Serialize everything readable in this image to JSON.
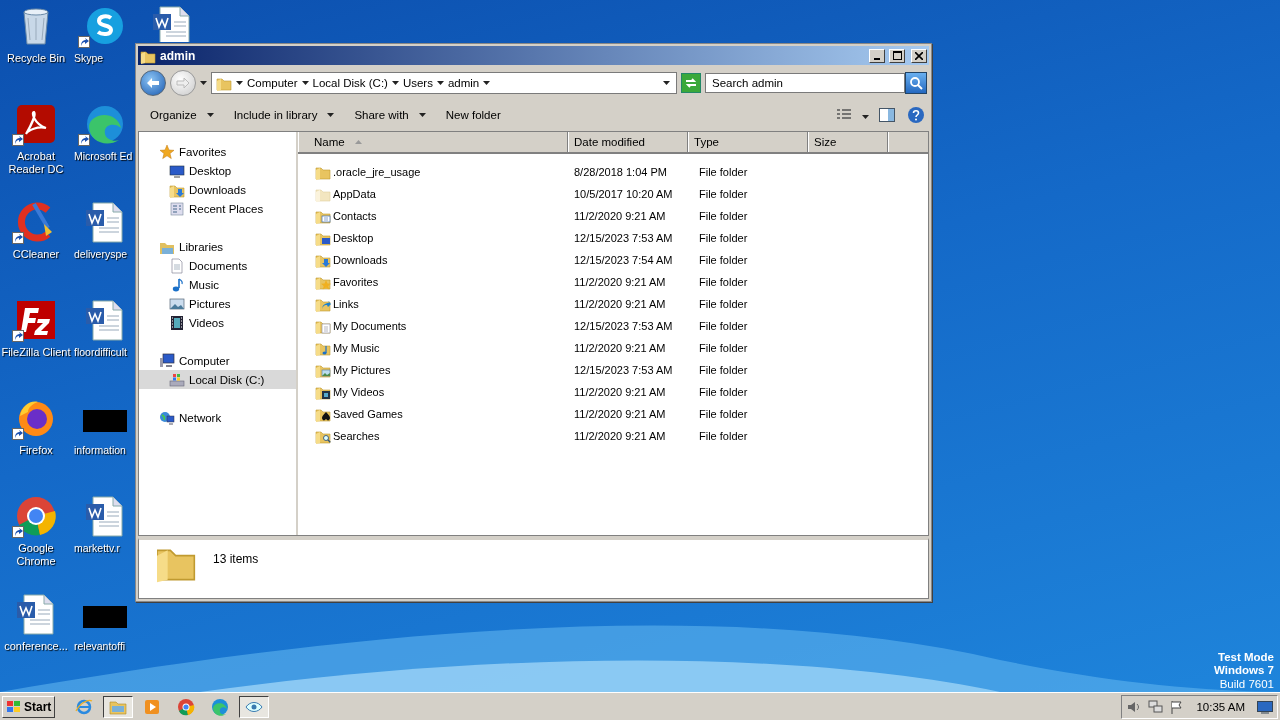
{
  "desktop_columns": [
    [
      {
        "label": "Recycle Bin",
        "kind": "recycle",
        "shortcut": false
      },
      {
        "label": "Acrobat Reader DC",
        "kind": "acrobat",
        "shortcut": true
      },
      {
        "label": "CCleaner",
        "kind": "ccleaner",
        "shortcut": true
      },
      {
        "label": "FileZilla Client",
        "kind": "filezilla",
        "shortcut": true
      },
      {
        "label": "Firefox",
        "kind": "firefox",
        "shortcut": true
      },
      {
        "label": "Google Chrome",
        "kind": "chrome",
        "shortcut": true
      },
      {
        "label": "conference...",
        "kind": "word",
        "shortcut": false
      }
    ],
    [
      {
        "label": "Skype",
        "kind": "skype",
        "shortcut": true
      },
      {
        "label": "Microsoft Ed",
        "kind": "edge",
        "shortcut": true
      },
      {
        "label": "deliveryspe",
        "kind": "word",
        "shortcut": false
      },
      {
        "label": "floordifficult",
        "kind": "word",
        "shortcut": false
      },
      {
        "label": "information",
        "kind": "redacted",
        "shortcut": false
      },
      {
        "label": "markettv.r",
        "kind": "word",
        "shortcut": false
      },
      {
        "label": "relevantoffi",
        "kind": "redacted",
        "shortcut": false
      }
    ],
    [
      {
        "kind": "word"
      }
    ]
  ],
  "window": {
    "title": "admin",
    "address": {
      "segments": [
        "Computer",
        "Local Disk (C:)",
        "Users",
        "admin"
      ]
    },
    "search": {
      "placeholder": "Search admin"
    },
    "toolbar": [
      {
        "label": "Organize",
        "dropdown": true
      },
      {
        "label": "Include in library",
        "dropdown": true
      },
      {
        "label": "Share with",
        "dropdown": true
      },
      {
        "label": "New folder",
        "dropdown": false
      }
    ],
    "nav": [
      {
        "label": "Favorites",
        "kind": "star",
        "selected": false,
        "children": [
          {
            "label": "Desktop",
            "kind": "desktop",
            "selected": false
          },
          {
            "label": "Downloads",
            "kind": "download",
            "selected": false
          },
          {
            "label": "Recent Places",
            "kind": "recent",
            "selected": false
          }
        ]
      },
      {
        "label": "Libraries",
        "kind": "library",
        "selected": false,
        "children": [
          {
            "label": "Documents",
            "kind": "document",
            "selected": false
          },
          {
            "label": "Music",
            "kind": "music",
            "selected": false
          },
          {
            "label": "Pictures",
            "kind": "picture",
            "selected": false
          },
          {
            "label": "Videos",
            "kind": "video",
            "selected": false
          }
        ]
      },
      {
        "label": "Computer",
        "kind": "computer",
        "selected": false,
        "children": [
          {
            "label": "Local Disk (C:)",
            "kind": "disk",
            "selected": true
          }
        ]
      },
      {
        "label": "Network",
        "kind": "network",
        "selected": false
      }
    ],
    "table": {
      "columns": [
        {
          "label": "Name",
          "sorted": true
        },
        {
          "label": "Date modified",
          "sorted": false
        },
        {
          "label": "Type",
          "sorted": false
        },
        {
          "label": "Size",
          "sorted": false
        }
      ],
      "rows": [
        {
          "name": ".oracle_jre_usage",
          "kind": "plain",
          "date": "8/28/2018 1:04 PM",
          "type": "File folder"
        },
        {
          "name": "AppData",
          "kind": "hidden",
          "date": "10/5/2017 10:20 AM",
          "type": "File folder"
        },
        {
          "name": "Contacts",
          "kind": "contacts",
          "date": "11/2/2020 9:21 AM",
          "type": "File folder"
        },
        {
          "name": "Desktop",
          "kind": "desktop",
          "date": "12/15/2023 7:53 AM",
          "type": "File folder"
        },
        {
          "name": "Downloads",
          "kind": "download",
          "date": "12/15/2023 7:54 AM",
          "type": "File folder"
        },
        {
          "name": "Favorites",
          "kind": "star",
          "date": "11/2/2020 9:21 AM",
          "type": "File folder"
        },
        {
          "name": "Links",
          "kind": "link",
          "date": "11/2/2020 9:21 AM",
          "type": "File folder"
        },
        {
          "name": "My Documents",
          "kind": "document",
          "date": "12/15/2023 7:53 AM",
          "type": "File folder"
        },
        {
          "name": "My Music",
          "kind": "music",
          "date": "11/2/2020 9:21 AM",
          "type": "File folder"
        },
        {
          "name": "My Pictures",
          "kind": "picture",
          "date": "12/15/2023 7:53 AM",
          "type": "File folder"
        },
        {
          "name": "My Videos",
          "kind": "video",
          "date": "11/2/2020 9:21 AM",
          "type": "File folder"
        },
        {
          "name": "Saved Games",
          "kind": "games",
          "date": "11/2/2020 9:21 AM",
          "type": "File folder"
        },
        {
          "name": "Searches",
          "kind": "search",
          "date": "11/2/2020 9:21 AM",
          "type": "File folder"
        }
      ]
    },
    "details": {
      "count": "13 items"
    }
  },
  "watermark_text": [
    "Test Mode",
    "Windows 7",
    "Build 7601"
  ],
  "taskbar": {
    "start": "Start",
    "apps": [
      {
        "kind": "ie",
        "selected": false
      },
      {
        "kind": "explorer",
        "selected": true
      },
      {
        "kind": "media",
        "selected": false
      },
      {
        "kind": "chrome",
        "selected": false
      },
      {
        "kind": "edge",
        "selected": false
      },
      {
        "kind": "eye",
        "selected": true
      }
    ],
    "clock": "10:35 AM"
  }
}
